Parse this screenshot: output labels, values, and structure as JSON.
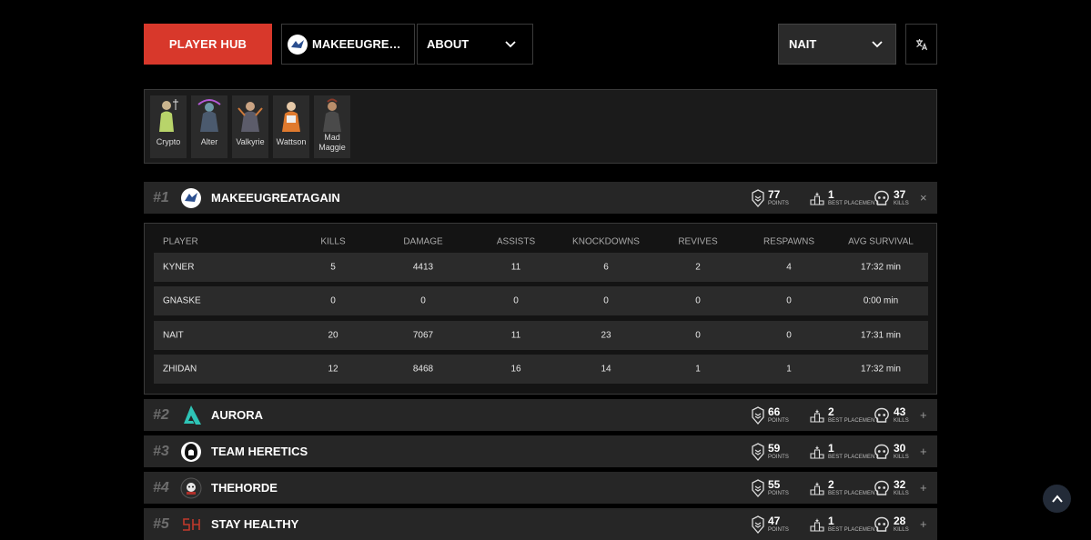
{
  "header": {
    "player_hub_label": "PLAYER HUB",
    "team_label": "MAKEEUGREAT...",
    "about_label": "ABOUT",
    "player_label": "NAIT"
  },
  "legends": [
    {
      "name": "Crypto"
    },
    {
      "name": "Alter"
    },
    {
      "name": "Valkyrie"
    },
    {
      "name": "Wattson"
    },
    {
      "name": "Mad Maggie"
    }
  ],
  "stat_labels": {
    "points": "POINTS",
    "best_placement": "BEST PLACEMENT",
    "kills": "KILLS"
  },
  "teams": [
    {
      "rank": "#1",
      "name": "MAKEEUGREATAGAIN",
      "points": "77",
      "best_placement": "1",
      "kills": "37",
      "toggle": "×"
    },
    {
      "rank": "#2",
      "name": "AURORA",
      "points": "66",
      "best_placement": "2",
      "kills": "43",
      "toggle": "+"
    },
    {
      "rank": "#3",
      "name": "TEAM HERETICS",
      "points": "59",
      "best_placement": "1",
      "kills": "30",
      "toggle": "+"
    },
    {
      "rank": "#4",
      "name": "THEHORDE",
      "points": "55",
      "best_placement": "2",
      "kills": "32",
      "toggle": "+"
    },
    {
      "rank": "#5",
      "name": "STAY HEALTHY",
      "points": "47",
      "best_placement": "1",
      "kills": "28",
      "toggle": "+"
    }
  ],
  "table": {
    "headers": [
      "PLAYER",
      "KILLS",
      "DAMAGE",
      "ASSISTS",
      "KNOCKDOWNS",
      "REVIVES",
      "RESPAWNS",
      "AVG SURVIVAL"
    ],
    "rows": [
      [
        "KYNER",
        "5",
        "4413",
        "11",
        "6",
        "2",
        "4",
        "17:32 min"
      ],
      [
        "GNASKE",
        "0",
        "0",
        "0",
        "0",
        "0",
        "0",
        "0:00 min"
      ],
      [
        "NAIT",
        "20",
        "7067",
        "11",
        "23",
        "0",
        "0",
        "17:31 min"
      ],
      [
        "ZHIDAN",
        "12",
        "8468",
        "16",
        "14",
        "1",
        "1",
        "17:32 min"
      ]
    ]
  },
  "colors": {
    "accent": "#d8382b",
    "row_bg": "#262626",
    "aurora": "#2ec4b6",
    "stay_healthy": "#c0392b"
  },
  "icons": [
    "chevron-down-icon",
    "translate-icon",
    "points-icon",
    "placement-icon",
    "skull-icon",
    "arrow-up-icon"
  ]
}
